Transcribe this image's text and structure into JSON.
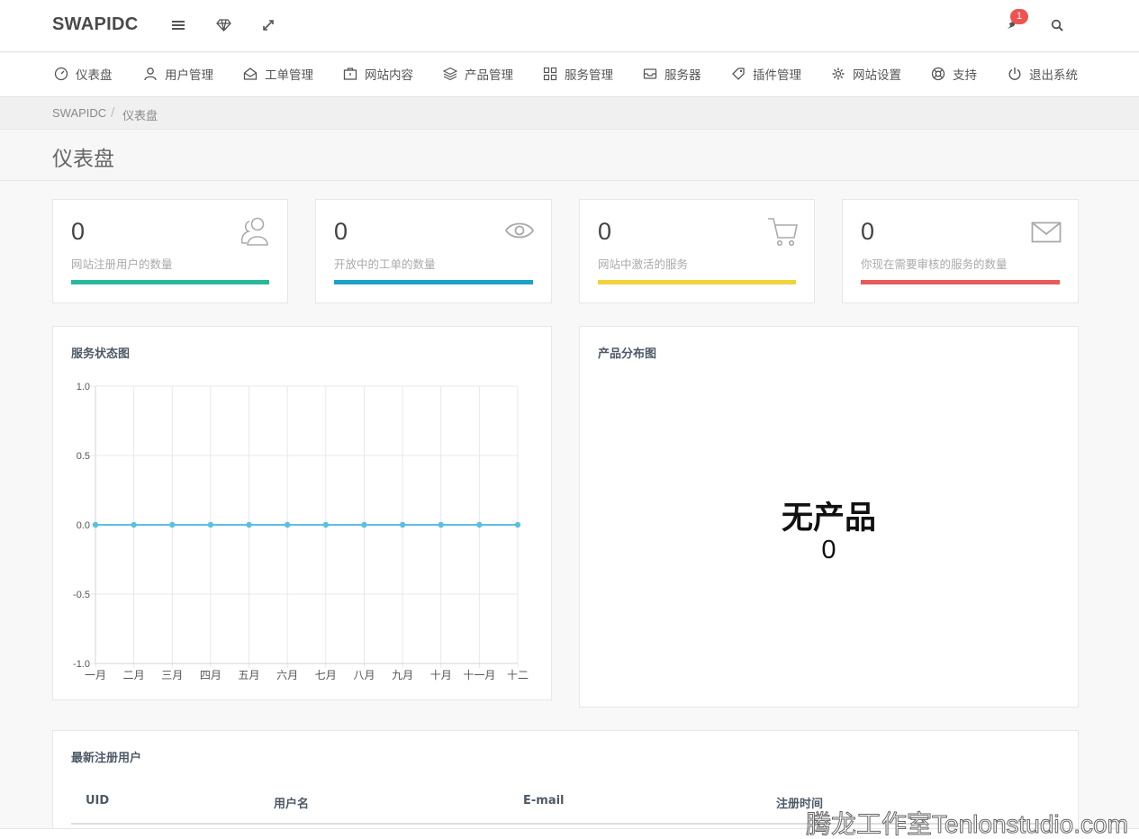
{
  "brand": "SWAPIDC",
  "topbar": {
    "notification_count": "1",
    "icons": [
      "menu-icon",
      "diamond-icon",
      "fullscreen-icon",
      "bell-icon",
      "search-icon"
    ]
  },
  "nav": {
    "items": [
      {
        "label": "仪表盘",
        "icon": "dashboard-icon"
      },
      {
        "label": "用户管理",
        "icon": "user-icon"
      },
      {
        "label": "工单管理",
        "icon": "inbox-icon"
      },
      {
        "label": "网站内容",
        "icon": "briefcase-icon"
      },
      {
        "label": "产品管理",
        "icon": "layers-icon"
      },
      {
        "label": "服务管理",
        "icon": "grid-icon"
      },
      {
        "label": "服务器",
        "icon": "drawer-icon"
      },
      {
        "label": "插件管理",
        "icon": "tag-icon"
      },
      {
        "label": "网站设置",
        "icon": "gear-icon"
      },
      {
        "label": "支持",
        "icon": "lifebuoy-icon"
      },
      {
        "label": "退出系统",
        "icon": "power-icon"
      }
    ]
  },
  "breadcrumb": {
    "home": "SWAPIDC",
    "sep": "/",
    "current": "仪表盘"
  },
  "page_title": "仪表盘",
  "stats": [
    {
      "value": "0",
      "label": "网站注册用户的数量",
      "color": "#26b99a",
      "icon": "users-icon"
    },
    {
      "value": "0",
      "label": "开放中的工单的数量",
      "color": "#1aa3c7",
      "icon": "eye-icon"
    },
    {
      "value": "0",
      "label": "网站中激活的服务",
      "color": "#f0d43a",
      "icon": "cart-icon"
    },
    {
      "value": "0",
      "label": "你现在需要审核的服务的数量",
      "color": "#e65b5b",
      "icon": "mail-icon"
    }
  ],
  "service_chart": {
    "title": "服务状态图"
  },
  "chart_data": {
    "type": "line",
    "categories": [
      "一月",
      "二月",
      "三月",
      "四月",
      "五月",
      "六月",
      "七月",
      "八月",
      "九月",
      "十月",
      "十一月",
      "十二"
    ],
    "values": [
      0,
      0,
      0,
      0,
      0,
      0,
      0,
      0,
      0,
      0,
      0,
      0
    ],
    "yticks": [
      "1.0",
      "0.5",
      "0.0",
      "-0.5",
      "-1.0"
    ],
    "ylim": [
      -1,
      1
    ],
    "grid": true,
    "color": "#5bc0de"
  },
  "product_chart": {
    "title": "产品分布图",
    "empty_text": "无产品",
    "empty_count": "0"
  },
  "latest_users": {
    "title": "最新注册用户",
    "columns": [
      "UID",
      "用户名",
      "E-mail",
      "注册时间"
    ]
  },
  "watermark": "腾龙工作室Tenlonstudio.com"
}
